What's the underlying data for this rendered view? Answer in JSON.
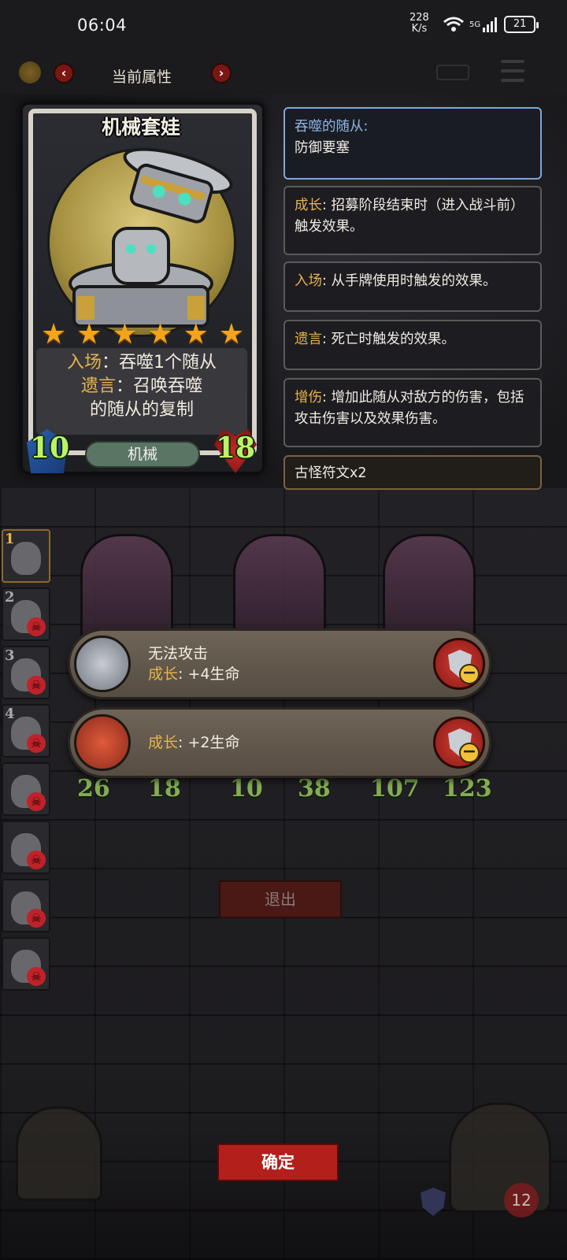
{
  "status_bar": {
    "time": "06:04",
    "net_speed_value": "228",
    "net_speed_unit": "K/s",
    "network": "5G",
    "battery": "21"
  },
  "header": {
    "title": "当前属性",
    "prev_icon": "chevron-left-icon",
    "next_icon": "chevron-right-icon"
  },
  "card": {
    "name": "机械套娃",
    "stars": 6,
    "text_line1_kw": "入场",
    "text_line1": "：吞噬1个随从",
    "text_line2_kw": "遗言",
    "text_line2": "：召唤吞噬",
    "text_line3": "的随从的复制",
    "attack": "10",
    "health": "18",
    "tribe": "机械"
  },
  "keywords": [
    {
      "label": "吞噬的随从:",
      "text": "防御要塞"
    },
    {
      "label": "成长",
      "text": ": 招募阶段结束时（进入战斗前）触发效果。"
    },
    {
      "label": "入场",
      "text": ": 从手牌使用时触发的效果。"
    },
    {
      "label": "遗言",
      "text": ": 死亡时触发的效果。"
    },
    {
      "label": "增伤",
      "text": ": 增加此随从对敌方的伤害，包括攻击伤害以及效果伤害。"
    },
    {
      "label": "",
      "text": "古怪符文x2"
    }
  ],
  "roster": [
    {
      "num": "1",
      "active": true
    },
    {
      "num": "2",
      "active": false
    },
    {
      "num": "3",
      "active": false
    },
    {
      "num": "4",
      "active": false
    },
    {
      "num": "",
      "active": false
    },
    {
      "num": "",
      "active": false
    },
    {
      "num": "",
      "active": false
    },
    {
      "num": "",
      "active": false
    }
  ],
  "board": [
    {
      "attack": "26",
      "health": "18"
    },
    {
      "attack": "10",
      "health": "38"
    },
    {
      "attack": "107",
      "health": "123"
    }
  ],
  "effects": [
    {
      "line1": "无法攻击",
      "kw": "成长",
      "line2": ": +4生命",
      "icon": "silver-coin-icon"
    },
    {
      "line1": "",
      "kw": "成长",
      "line2": ": +2生命",
      "icon": "red-rune-icon"
    }
  ],
  "buttons": {
    "exit": "退出",
    "confirm": "确定"
  },
  "hero": {
    "health": "12"
  },
  "colors": {
    "keyword": "#e6b44a",
    "selected_border": "#7ea7d6",
    "confirm": "#b3201c",
    "stat_green": "#bff06a"
  }
}
